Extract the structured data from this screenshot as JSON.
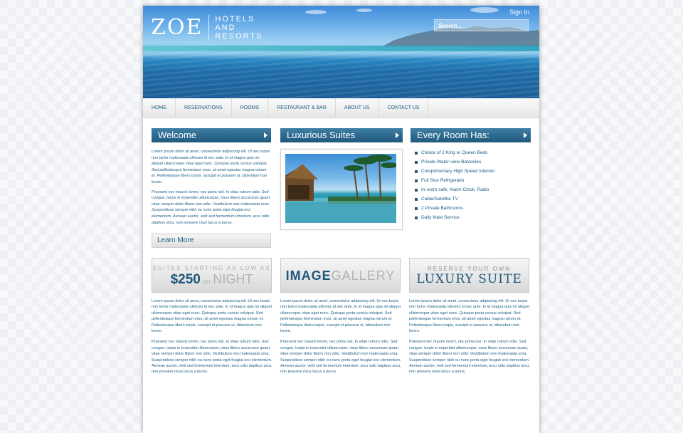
{
  "header": {
    "logo_mark": "ZOE",
    "logo_lines": [
      "HOTELS",
      "AND",
      "RESORTS"
    ],
    "signin": "Sign In",
    "search_placeholder": "Search..."
  },
  "nav": [
    "HOME",
    "RESERVATIONS",
    "ROOMS",
    "RESTAURANT & BAR",
    "ABOUT US",
    "CONTACT US"
  ],
  "welcome": {
    "title": "Welcome",
    "p1": "Lorem ipsum dolor sit amet, consectetur adipiscing elit. Ut nec turpis non tortor malesuada ultricies id nec ante. In id magna quis mi aliquet ullamcorper vitae eget nunc. Quisque porta cursus volutpat. Sed pellentesque fermentum eros, sit amet egestas magna rutrum et. Pellentesque libero turpis, suscipit et posuere ut, bibendum non lorem.",
    "p2": "Praesent nec mauris lorem, nec porta nisl. In vitae rutrum odio. Sed congue, turpis in imperdiet ullamcorper, risus libero accumsan quam, vitae semper dolor libero non odio. Vestibulum non malesuada urna. Suspendisse semper nibh eu nunc porta eget feugiat orci elementum. Aenean auctor, velit sed fermentum interdum, arcu odio dapibus arcu, non posuere risus lacus a purus.",
    "learn_more": "Learn More"
  },
  "suites": {
    "title": "Luxurious Suites"
  },
  "room": {
    "title": "Every Room Has:",
    "items": [
      "Choice of 2 King or Queen Beds",
      "Private Water-view Balconies",
      "Complimentary High Speed Internet",
      "Full Size Refrigerator",
      "In-room safe, Alarm Clock, Radio",
      "Cable/Satellite TV",
      "2 Private Bathrooms",
      "Daily Maid Service"
    ]
  },
  "promos": {
    "p1_line1": "SUITES STARTING AS LOW AS",
    "p1_price": "$250",
    "p1_per": "per",
    "p1_night": "NIGHT",
    "p2_a": "IMAGE",
    "p2_b": "GALLERY",
    "p3_line1": "RESERVE YOUR OWN",
    "p3_line2": "LUXURY SUITE"
  },
  "columns": {
    "p1": "Lorem ipsum dolor sit amet, consectetur adipiscing elit. Ut nec turpis non tortor malesuada ultricies id nec ante. In id magna quis mi aliquet ullamcorper vitae eget nunc. Quisque porta cursus volutpat. Sed pellentesque fermentum eros, sit amet egestas magna rutrum et. Pellentesque libero turpis, suscipit et posuere ut, bibendum non lorem.",
    "p2": "Praesent nec mauris lorem, nec porta nisl. In vitae rutrum odio. Sed congue, turpis in imperdiet ullamcorper, risus libero accumsan quam, vitae semper dolor libero non odio. Vestibulum non malesuada urna. Suspendisse semper nibh eu nunc porta eget feugiat orci elementum. Aenean auctor, velit sed fermentum interdum, arcu odio dapibus arcu, non posuere risus lacus a purus."
  },
  "colors": {
    "accent": "#1f587c",
    "text": "#1c5d85"
  }
}
